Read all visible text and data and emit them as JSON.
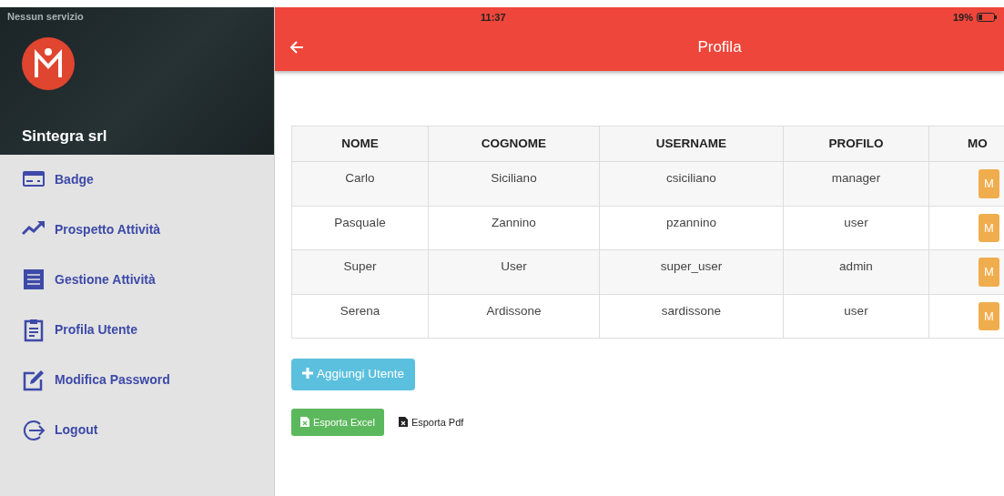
{
  "status_bar": {
    "carrier": "Nessun servizio",
    "time": "11:37",
    "battery": "19%"
  },
  "sidebar": {
    "company": "Sintegra srl",
    "items": [
      {
        "label": "Badge"
      },
      {
        "label": "Prospetto Attività"
      },
      {
        "label": "Gestione Attività"
      },
      {
        "label": "Profila Utente"
      },
      {
        "label": "Modifica Password"
      },
      {
        "label": "Logout"
      }
    ]
  },
  "app_bar": {
    "title": "Profila"
  },
  "table": {
    "columns": [
      "NOME",
      "COGNOME",
      "USERNAME",
      "PROFILO",
      "MO"
    ],
    "rows": [
      {
        "cells": [
          "Carlo",
          "Siciliano",
          "csiciliano",
          "manager"
        ],
        "action": "M"
      },
      {
        "cells": [
          "Pasquale",
          "Zannino",
          "pzannino",
          "user"
        ],
        "action": "M"
      },
      {
        "cells": [
          "Super",
          "User",
          "super_user",
          "admin"
        ],
        "action": "M"
      },
      {
        "cells": [
          "Serena",
          "Ardissone",
          "sardissone",
          "user"
        ],
        "action": "M"
      }
    ]
  },
  "add_button": {
    "label": "Aggiungi Utente"
  },
  "export": [
    {
      "label": "Esporta Excel",
      "kind": "button"
    },
    {
      "label": "Esporta Pdf",
      "kind": "link"
    }
  ]
}
